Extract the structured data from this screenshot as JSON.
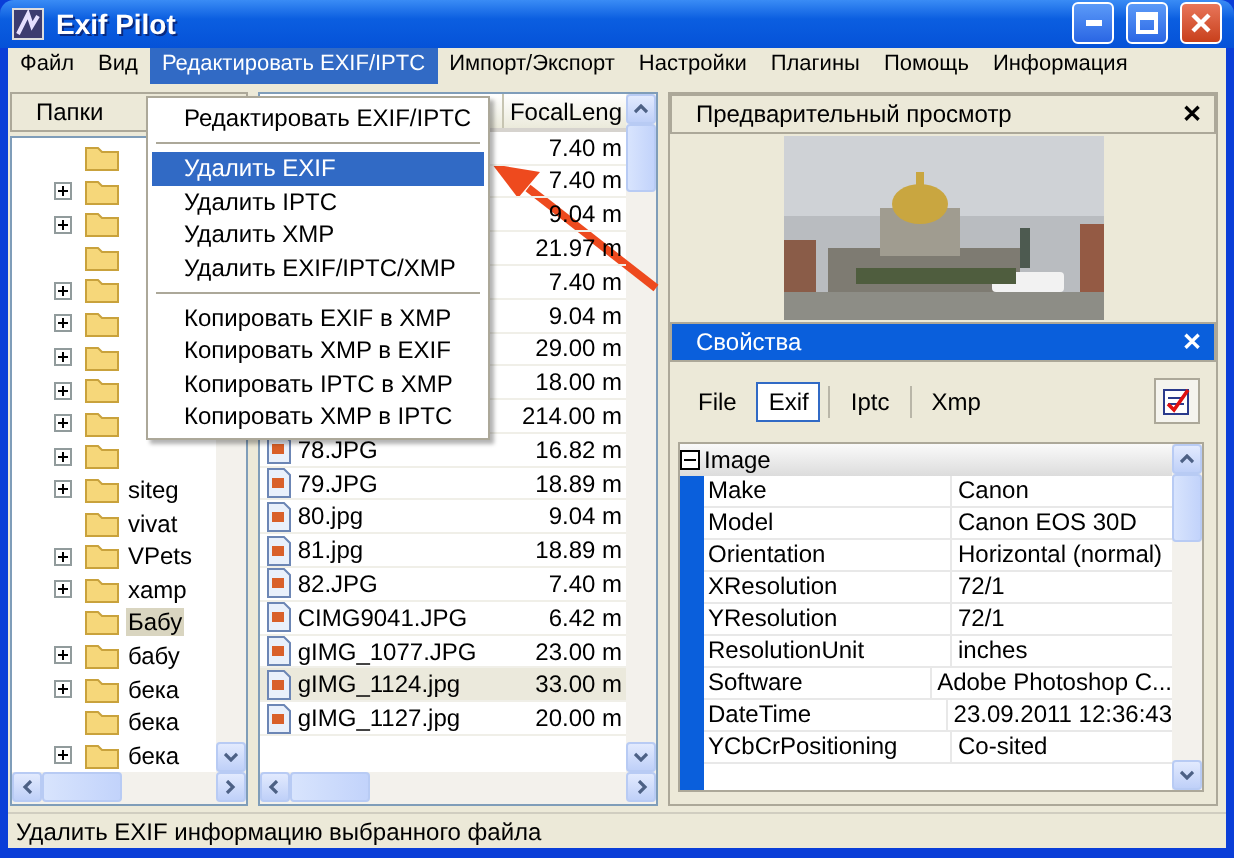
{
  "window": {
    "title": "Exif Pilot"
  },
  "menu": [
    {
      "label": "Файл",
      "selected": false
    },
    {
      "label": "Вид",
      "selected": false
    },
    {
      "label": "Редактировать EXIF/IPTC",
      "selected": true
    },
    {
      "label": "Импорт/Экспорт",
      "selected": false
    },
    {
      "label": "Настройки",
      "selected": false
    },
    {
      "label": "Плагины",
      "selected": false
    },
    {
      "label": "Помощь",
      "selected": false
    },
    {
      "label": "Информация",
      "selected": false
    }
  ],
  "dropdown": [
    {
      "kind": "item",
      "label": "Редактировать EXIF/IPTC",
      "selected": false
    },
    {
      "kind": "separator"
    },
    {
      "kind": "item",
      "label": "Удалить EXIF",
      "selected": true
    },
    {
      "kind": "item",
      "label": "Удалить IPTC",
      "selected": false
    },
    {
      "kind": "item",
      "label": "Удалить XMP",
      "selected": false
    },
    {
      "kind": "item",
      "label": "Удалить EXIF/IPTC/XMP",
      "selected": false
    },
    {
      "kind": "separator"
    },
    {
      "kind": "item",
      "label": "Копировать EXIF в XMP",
      "selected": false
    },
    {
      "kind": "item",
      "label": "Копировать XMP в EXIF",
      "selected": false
    },
    {
      "kind": "item",
      "label": "Копировать IPTC в XMP",
      "selected": false
    },
    {
      "kind": "item",
      "label": "Копировать XMP в IPTC",
      "selected": false
    }
  ],
  "folders": {
    "title": "Папки",
    "items": [
      {
        "expandable": false,
        "selected": false
      },
      {
        "expandable": true,
        "selected": false
      },
      {
        "expandable": true,
        "selected": false
      },
      {
        "expandable": false,
        "selected": false
      },
      {
        "expandable": true,
        "selected": false
      },
      {
        "expandable": true,
        "selected": false
      },
      {
        "expandable": true,
        "selected": false
      },
      {
        "expandable": true,
        "selected": false
      },
      {
        "expandable": true,
        "selected": false
      },
      {
        "expandable": true,
        "selected": false
      },
      {
        "label": "siteg",
        "expandable": true,
        "selected": false
      },
      {
        "label": "vivat",
        "expandable": false,
        "selected": false
      },
      {
        "label": "VPets",
        "expandable": true,
        "selected": false
      },
      {
        "label": "xamp",
        "expandable": true,
        "selected": false
      },
      {
        "label": "Бабу",
        "expandable": false,
        "selected": true
      },
      {
        "label": "бабу",
        "expandable": true,
        "selected": false
      },
      {
        "label": "бека",
        "expandable": true,
        "selected": false
      },
      {
        "label": "бека",
        "expandable": false,
        "selected": false
      },
      {
        "label": "бека",
        "expandable": true,
        "selected": false
      }
    ]
  },
  "files": {
    "columns": [
      "FocalLeng"
    ],
    "rows": [
      {
        "focal": "7.40 m",
        "selected": false
      },
      {
        "focal": "7.40 m",
        "selected": false
      },
      {
        "focal": "9.04 m",
        "selected": false
      },
      {
        "focal": "21.97 m",
        "selected": false
      },
      {
        "focal": "7.40 m",
        "selected": false
      },
      {
        "focal": "9.04 m",
        "selected": false
      },
      {
        "focal": "29.00 m",
        "selected": false
      },
      {
        "focal": "18.00 m",
        "selected": false
      },
      {
        "focal": "214.00 m",
        "selected": false
      },
      {
        "name": "78.JPG",
        "focal": "16.82 m",
        "selected": false
      },
      {
        "name": "79.JPG",
        "focal": "18.89 m",
        "selected": false
      },
      {
        "name": "80.jpg",
        "focal": "9.04 m",
        "selected": false
      },
      {
        "name": "81.jpg",
        "focal": "18.89 m",
        "selected": false
      },
      {
        "name": "82.JPG",
        "focal": "7.40 m",
        "selected": false
      },
      {
        "name": "CIMG9041.JPG",
        "focal": "6.42 m",
        "selected": false
      },
      {
        "name": "gIMG_1077.JPG",
        "focal": "23.00 m",
        "selected": false
      },
      {
        "name": "gIMG_1124.jpg",
        "focal": "33.00 m",
        "selected": true
      },
      {
        "name": "gIMG_1127.jpg",
        "focal": "20.00 m",
        "selected": false
      }
    ]
  },
  "preview": {
    "title": "Предварительный просмотр",
    "close": "✕"
  },
  "properties": {
    "title": "Свойства",
    "close": "✕",
    "tabs": [
      {
        "label": "File",
        "selected": false
      },
      {
        "label": "Exif",
        "selected": true
      },
      {
        "label": "Iptc",
        "selected": false
      },
      {
        "label": "Xmp",
        "selected": false
      }
    ],
    "group": "Image",
    "rows": [
      {
        "name": "Make",
        "value": "Canon"
      },
      {
        "name": "Model",
        "value": "Canon EOS 30D"
      },
      {
        "name": "Orientation",
        "value": "Horizontal (normal)"
      },
      {
        "name": "XResolution",
        "value": "72/1"
      },
      {
        "name": "YResolution",
        "value": "72/1"
      },
      {
        "name": "ResolutionUnit",
        "value": "inches"
      },
      {
        "name": "Software",
        "value": "Adobe Photoshop C..."
      },
      {
        "name": "DateTime",
        "value": "23.09.2011 12:36:43"
      },
      {
        "name": "YCbCrPositioning",
        "value": "Co-sited"
      }
    ]
  },
  "status_bar": "Удалить EXIF информацию выбранного файла"
}
